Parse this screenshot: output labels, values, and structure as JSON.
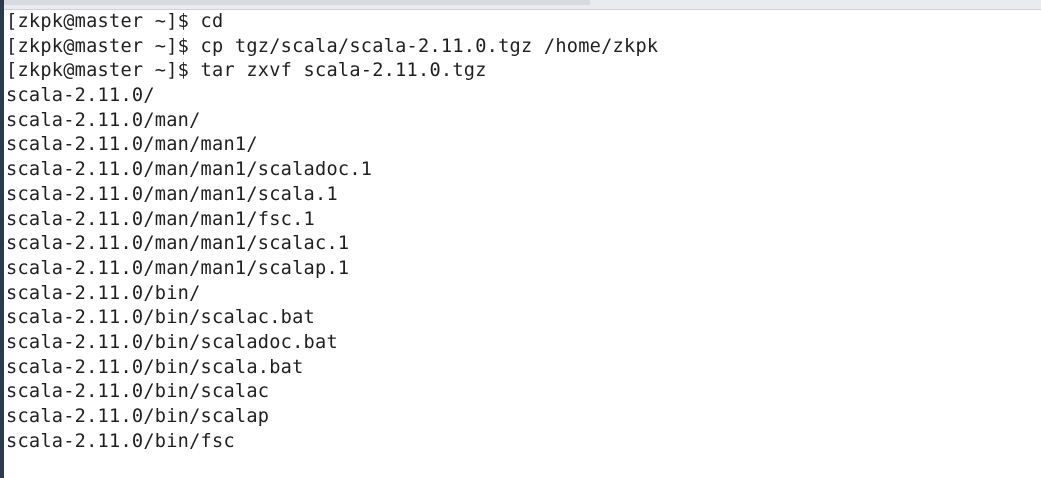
{
  "terminal": {
    "lines": [
      "[zkpk@master ~]$ cd",
      "[zkpk@master ~]$ cp tgz/scala/scala-2.11.0.tgz /home/zkpk",
      "[zkpk@master ~]$ tar zxvf scala-2.11.0.tgz",
      "scala-2.11.0/",
      "scala-2.11.0/man/",
      "scala-2.11.0/man/man1/",
      "scala-2.11.0/man/man1/scaladoc.1",
      "scala-2.11.0/man/man1/scala.1",
      "scala-2.11.0/man/man1/fsc.1",
      "scala-2.11.0/man/man1/scalac.1",
      "scala-2.11.0/man/man1/scalap.1",
      "scala-2.11.0/bin/",
      "scala-2.11.0/bin/scalac.bat",
      "scala-2.11.0/bin/scaladoc.bat",
      "scala-2.11.0/bin/scala.bat",
      "scala-2.11.0/bin/scalac",
      "scala-2.11.0/bin/scalap",
      "scala-2.11.0/bin/fsc"
    ]
  },
  "colors": {
    "background": "#ffffff",
    "text": "#1f1f1f",
    "edge": "#2b3a4e"
  }
}
